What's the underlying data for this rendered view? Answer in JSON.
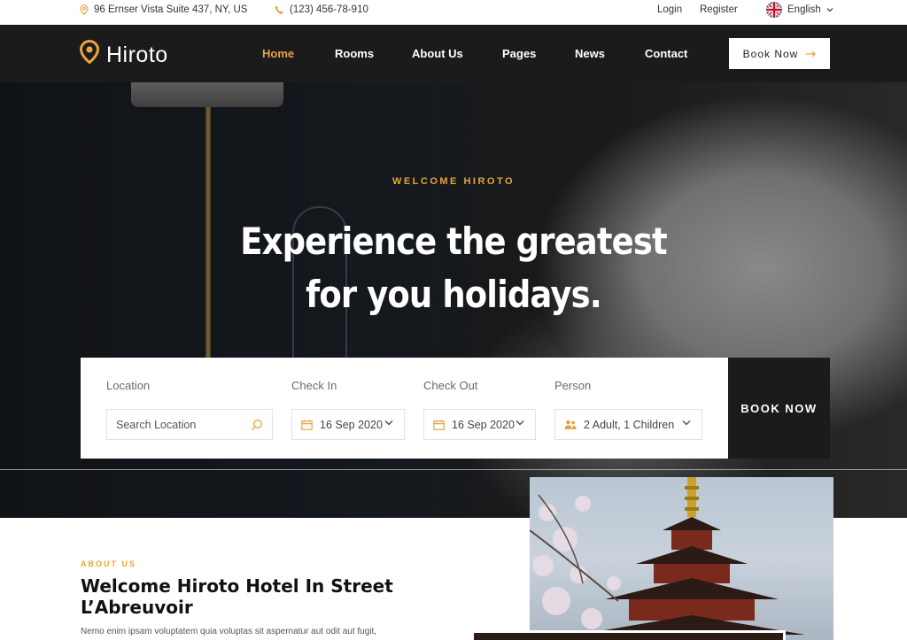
{
  "topbar": {
    "address": "96 Ernser Vista Suite 437, NY, US",
    "phone": "(123) 456-78-910",
    "login": "Login",
    "register": "Register",
    "language": "English"
  },
  "navbar": {
    "brand": "Hiroto",
    "items": [
      {
        "label": "Home",
        "active": true
      },
      {
        "label": "Rooms"
      },
      {
        "label": "About Us"
      },
      {
        "label": "Pages"
      },
      {
        "label": "News"
      },
      {
        "label": "Contact"
      }
    ],
    "book_now": "Book Now"
  },
  "hero": {
    "subtitle": "WELCOME HIROTO",
    "title_line1": "Experience the greatest",
    "title_line2": "for you holidays."
  },
  "search": {
    "location_label": "Location",
    "location_placeholder": "Search Location",
    "checkin_label": "Check In",
    "checkin_value": "16 Sep 2020",
    "checkout_label": "Check Out",
    "checkout_value": "16 Sep 2020",
    "person_label": "Person",
    "person_value": "2 Adult, 1 Children",
    "book_now": "BOOK NOW"
  },
  "about": {
    "eyebrow": "ABOUT US",
    "title": "Welcome Hiroto Hotel In Street L’Abreuvoir",
    "text": "Nemo enim ipsam voluptatem quia voluptas sit aspernatur aut odit aut fugit,"
  },
  "colors": {
    "accent": "#e8a33c",
    "dark": "#1b1b1b"
  }
}
